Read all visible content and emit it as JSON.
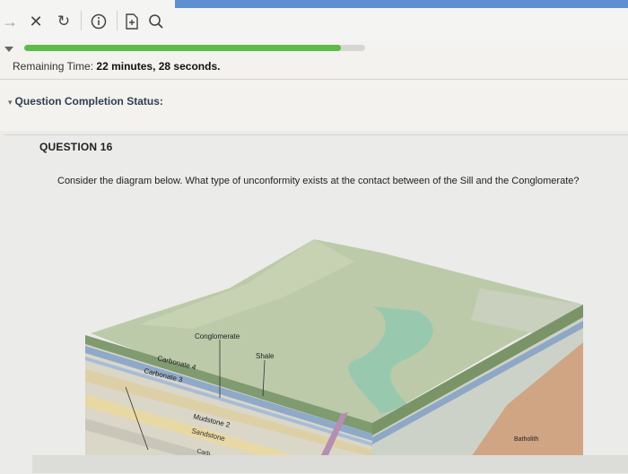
{
  "toolbar": {
    "icons": [
      "forward-arrow-icon",
      "close-icon",
      "reload-icon",
      "info-icon",
      "document-icon",
      "search-icon"
    ]
  },
  "progress": {
    "fraction": 0.93
  },
  "timer": {
    "label": "Remaining Time:",
    "value": "22 minutes, 28 seconds."
  },
  "status": {
    "arrow": "▾",
    "label": "Question Completion Status:"
  },
  "question": {
    "title": "QUESTION 16",
    "text": "Consider the diagram below. What type of unconformity exists at the contact between of the Sill and the Conglomerate?"
  },
  "diagram": {
    "labels": {
      "conglomerate": "Conglomerate",
      "shale": "Shale",
      "carbonate4": "Carbonate 4",
      "carbonate3": "Carbonate 3",
      "mudstone2": "Mudstone 2",
      "sandstone": "Sandstone",
      "carb": "Carb",
      "batholith": "Batholith"
    },
    "colors": {
      "terrain": "#b9c9a8",
      "river": "#8fc9ae",
      "carbonate": "#8ea7c7",
      "sandstone": "#e8d9a4",
      "batholith": "#cfa583",
      "mudstone": "#d9d5c6"
    }
  }
}
